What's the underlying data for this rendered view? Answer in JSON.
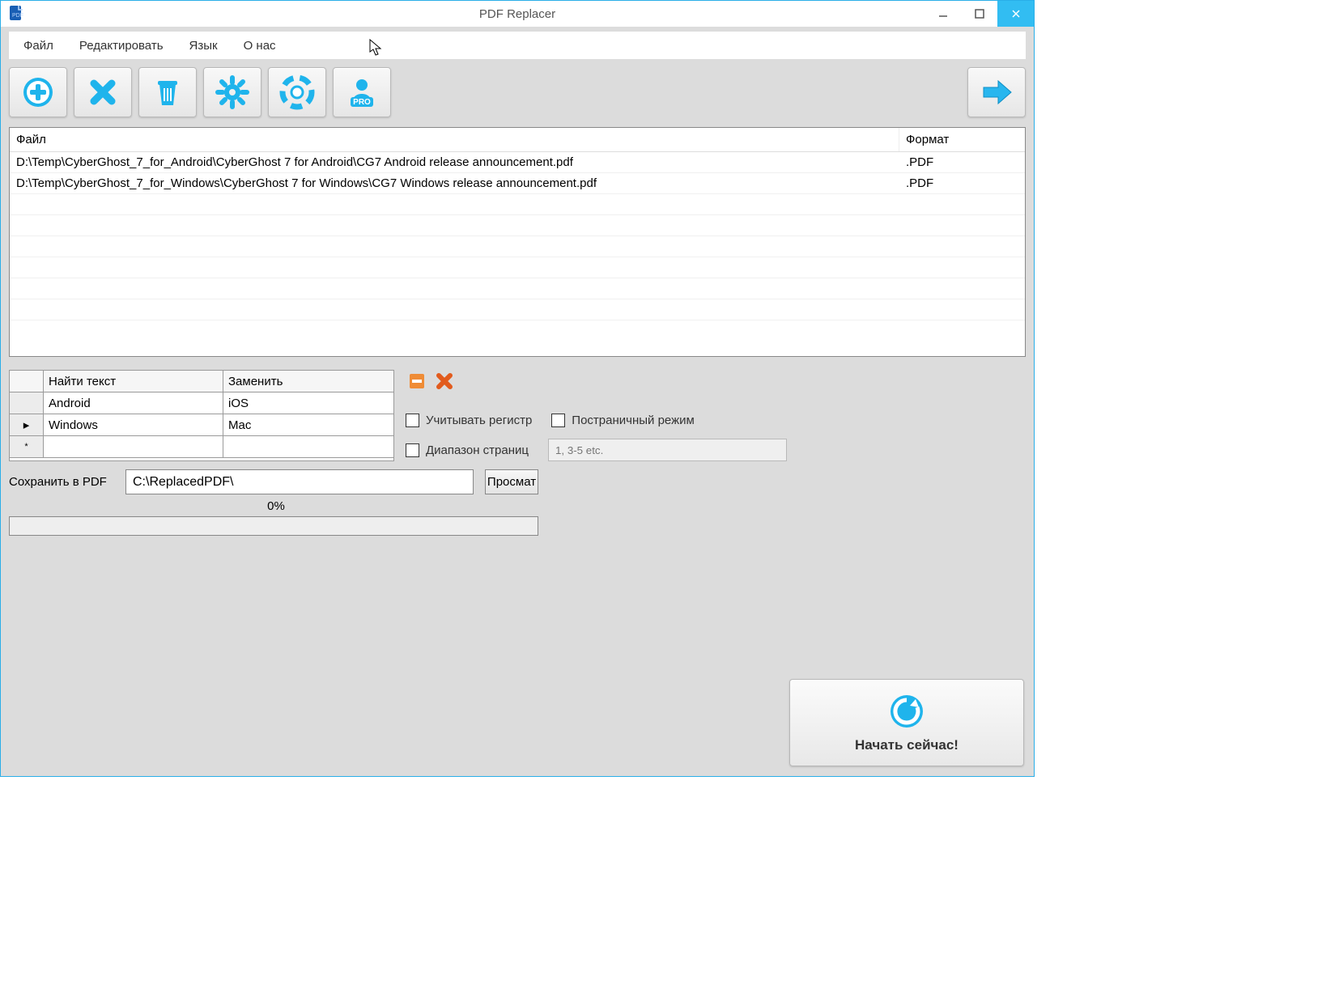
{
  "window": {
    "title": "PDF Replacer"
  },
  "menu": {
    "file": "Файл",
    "edit": "Редактировать",
    "lang": "Язык",
    "about": "О нас"
  },
  "toolbar": {
    "add": "add",
    "delete": "delete",
    "clear": "clear",
    "settings": "settings",
    "help": "help",
    "pro": "PRO",
    "next": "next"
  },
  "filelist": {
    "col_file": "Файл",
    "col_format": "Формат",
    "rows": [
      {
        "file": "D:\\Temp\\CyberGhost_7_for_Android\\CyberGhost 7 for Android\\CG7 Android release announcement.pdf",
        "fmt": ".PDF"
      },
      {
        "file": "D:\\Temp\\CyberGhost_7_for_Windows\\CyberGhost 7 for Windows\\CG7 Windows release announcement.pdf",
        "fmt": ".PDF"
      }
    ]
  },
  "replace": {
    "col_find": "Найти текст",
    "col_repl": "Заменить",
    "rows": [
      {
        "find": "Android",
        "repl": "iOS"
      },
      {
        "find": "Windows",
        "repl": "Mac"
      }
    ]
  },
  "options": {
    "case": "Учитывать регистр",
    "pagewise": "Постраничный режим",
    "range": "Диапазон страниц",
    "range_placeholder": "1, 3-5 etc."
  },
  "save": {
    "label": "Сохранить в PDF",
    "path": "C:\\ReplacedPDF\\",
    "browse": "Просмат"
  },
  "progress": {
    "pct": "0%"
  },
  "start": {
    "label": "Начать сейчас!"
  }
}
